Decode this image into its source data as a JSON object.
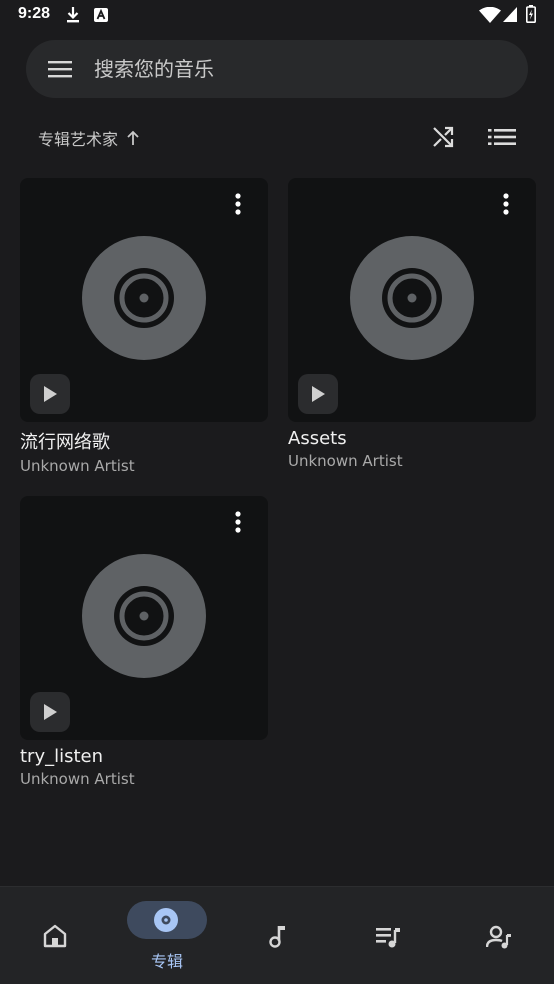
{
  "status": {
    "time": "9:28",
    "left_icons": [
      "download-icon",
      "font-a-icon"
    ],
    "right_icons": [
      "wifi-icon",
      "signal-icon",
      "battery-icon"
    ]
  },
  "search": {
    "placeholder": "搜索您的音乐",
    "menu_icon": "menu-icon"
  },
  "sort": {
    "label": "专辑艺术家",
    "direction": "ascending"
  },
  "albums": [
    {
      "title": "流行网络歌",
      "artist": "Unknown Artist"
    },
    {
      "title": "Assets",
      "artist": "Unknown Artist"
    },
    {
      "title": "try_listen",
      "artist": "Unknown Artist"
    }
  ],
  "nav": {
    "items": [
      {
        "icon": "home-icon",
        "label": ""
      },
      {
        "icon": "album-icon",
        "label": "专辑",
        "active": true
      },
      {
        "icon": "music-note-icon",
        "label": ""
      },
      {
        "icon": "playlist-icon",
        "label": ""
      },
      {
        "icon": "artist-icon",
        "label": ""
      }
    ]
  },
  "colors": {
    "background": "#1b1b1d",
    "accent": "#a8c6f5",
    "disc": "#5f6265",
    "card": "#111213"
  }
}
